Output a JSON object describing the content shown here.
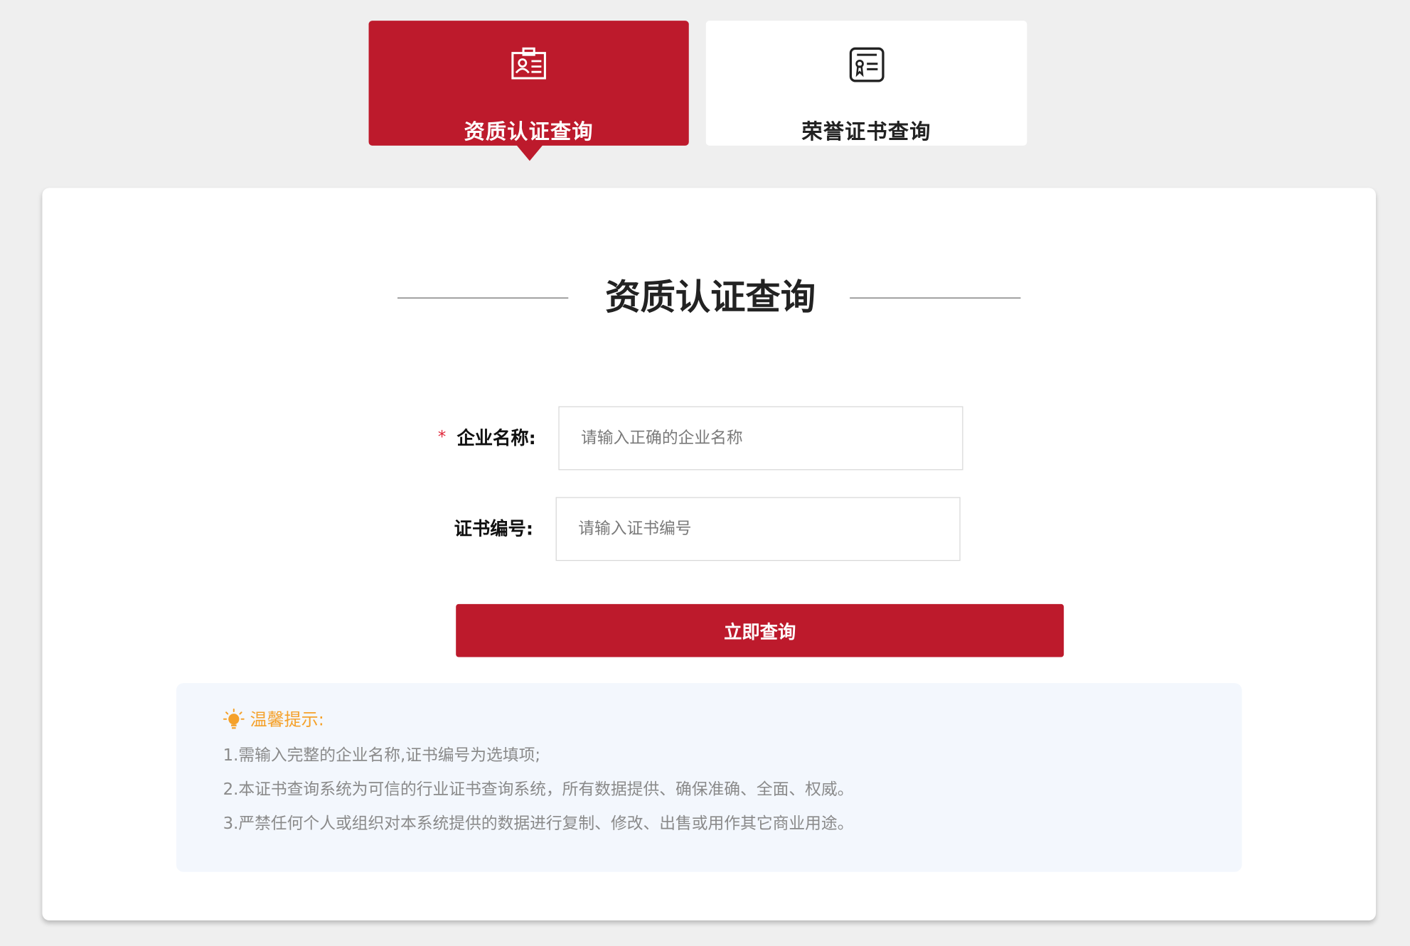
{
  "tabs": [
    {
      "label": "资质认证查询",
      "icon": "id-badge-icon",
      "active": true
    },
    {
      "label": "荣誉证书查询",
      "icon": "certificate-list-icon",
      "active": false
    }
  ],
  "section": {
    "title": "资质认证查询"
  },
  "form": {
    "company": {
      "required_mark": "*",
      "label": "企业名称:",
      "placeholder": "请输入正确的企业名称",
      "value": ""
    },
    "certificate": {
      "label": "证书编号:",
      "placeholder": "请输入证书编号",
      "value": ""
    },
    "submit_label": "立即查询"
  },
  "tips": {
    "icon": "lightbulb-icon",
    "title": "温馨提示:",
    "lines": [
      "1.需输入完整的企业名称,证书编号为选填项;",
      "2.本证书查询系统为可信的行业证书查询系统，所有数据提供、确保准确、全面、权威。",
      "3.严禁任何个人或组织对本系统提供的数据进行复制、修改、出售或用作其它商业用途。"
    ]
  },
  "colors": {
    "accent": "#bd1a2c",
    "page_background": "#efefef",
    "tips_background": "#f3f7fd",
    "tips_title": "#f5a12a",
    "required_mark": "#e0283b"
  }
}
